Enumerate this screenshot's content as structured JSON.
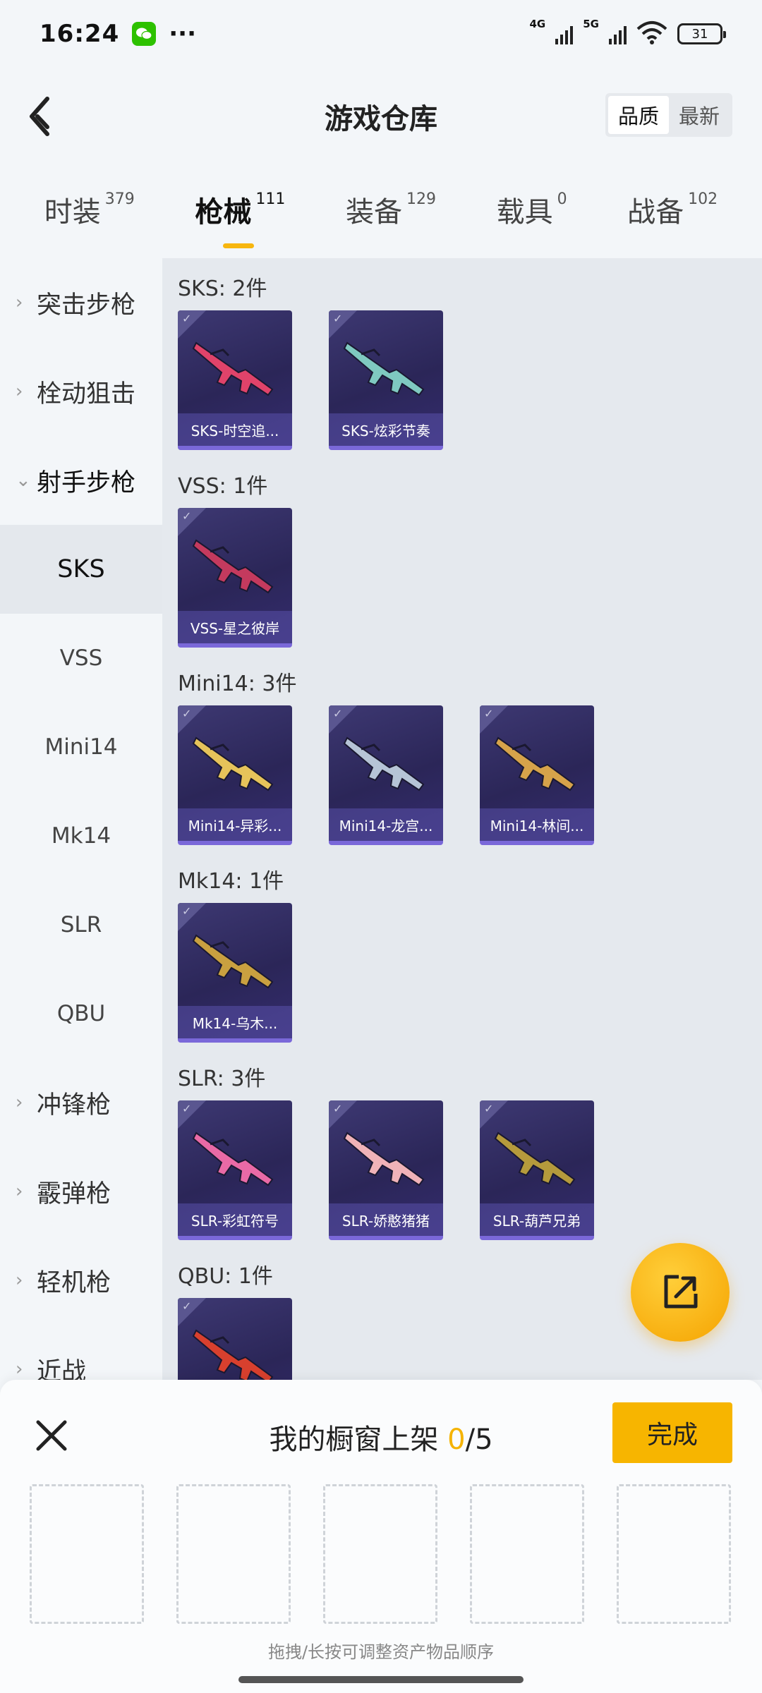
{
  "status": {
    "time": "16:24",
    "net1": "4G",
    "net2": "5G",
    "battery": "31"
  },
  "header": {
    "title": "游戏仓库",
    "sort": [
      "品质",
      "最新"
    ]
  },
  "tabs": [
    {
      "label": "时装",
      "count": "379"
    },
    {
      "label": "枪械",
      "count": "111"
    },
    {
      "label": "装备",
      "count": "129"
    },
    {
      "label": "载具",
      "count": "0"
    },
    {
      "label": "战备",
      "count": "102"
    }
  ],
  "sidebar": {
    "cat1": "突击步枪",
    "cat2": "栓动狙击",
    "cat3": "射手步枪",
    "subs": [
      "SKS",
      "VSS",
      "Mini14",
      "Mk14",
      "SLR",
      "QBU"
    ],
    "cat4": "冲锋枪",
    "cat5": "霰弹枪",
    "cat6": "轻机枪",
    "cat7": "近战"
  },
  "groups": [
    {
      "title": "SKS: 2件",
      "items": [
        {
          "name": "SKS-时空追...",
          "gun_color": "#e0436a"
        },
        {
          "name": "SKS-炫彩节奏",
          "gun_color": "#7fc9c0"
        }
      ]
    },
    {
      "title": "VSS: 1件",
      "items": [
        {
          "name": "VSS-星之彼岸",
          "gun_color": "#c43a5e"
        }
      ]
    },
    {
      "title": "Mini14: 3件",
      "items": [
        {
          "name": "Mini14-异彩...",
          "gun_color": "#e6c35a"
        },
        {
          "name": "Mini14-龙宫...",
          "gun_color": "#b6c4d6"
        },
        {
          "name": "Mini14-林间...",
          "gun_color": "#d6a34a"
        }
      ]
    },
    {
      "title": "Mk14: 1件",
      "items": [
        {
          "name": "Mk14-乌木...",
          "gun_color": "#c9a040"
        }
      ]
    },
    {
      "title": "SLR: 3件",
      "items": [
        {
          "name": "SLR-彩虹符号",
          "gun_color": "#e96aa6"
        },
        {
          "name": "SLR-娇憨猪猪",
          "gun_color": "#f0b3b8"
        },
        {
          "name": "SLR-葫芦兄弟",
          "gun_color": "#b59a3c"
        }
      ]
    },
    {
      "title": "QBU: 1件",
      "items": [
        {
          "name": "",
          "gun_color": "#d8402e"
        }
      ]
    }
  ],
  "panel": {
    "title": "我的橱窗上架",
    "current": "0",
    "total": "/5",
    "done": "完成",
    "hint": "拖拽/长按可调整资产物品顺序"
  },
  "colors": {
    "accent": "#f7b500",
    "card_bg": "#2b2658",
    "card_border": "#7a68d9"
  }
}
